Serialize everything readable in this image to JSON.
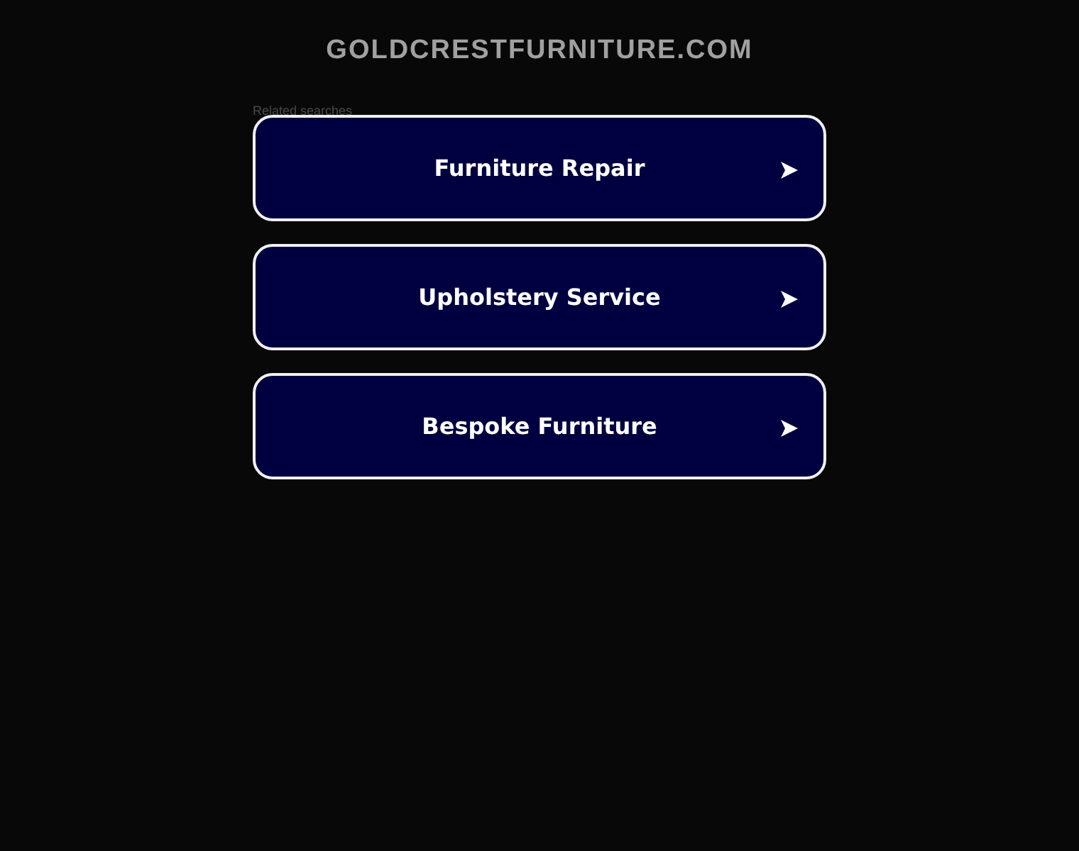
{
  "domain": "GOLDCRESTFURNITURE.COM",
  "related_label": "Related searches",
  "links": [
    {
      "label": "Furniture Repair"
    },
    {
      "label": "Upholstery Service"
    },
    {
      "label": "Bespoke Furniture"
    }
  ]
}
